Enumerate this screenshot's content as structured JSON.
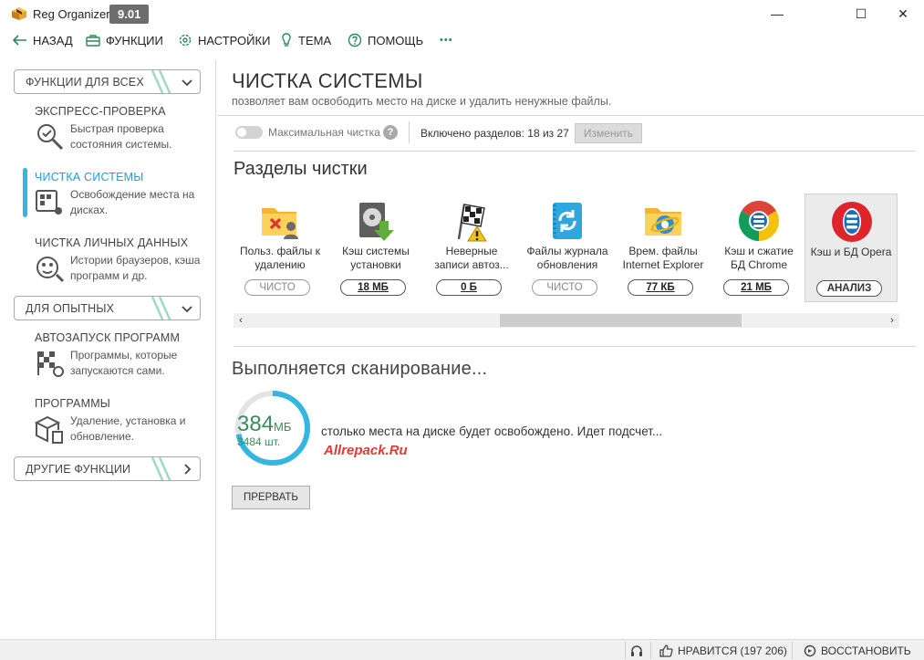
{
  "window": {
    "title": "Reg Organizer",
    "version": "9.01",
    "controls": {
      "minimize": "—",
      "maximize": "☐",
      "close": "✕"
    }
  },
  "menu": {
    "back": "НАЗАД",
    "functions": "ФУНКЦИИ",
    "settings": "НАСТРОЙКИ",
    "theme": "ТЕМА",
    "help": "ПОМОЩЬ",
    "more": "•••"
  },
  "sidebar": {
    "group_all": "ФУНКЦИИ ДЛЯ ВСЕХ",
    "group_advanced": "ДЛЯ ОПЫТНЫХ",
    "group_other": "ДРУГИЕ ФУНКЦИИ",
    "items": [
      {
        "title": "ЭКСПРЕСС-ПРОВЕРКА",
        "desc": "Быстрая проверка состояния системы."
      },
      {
        "title": "ЧИСТКА СИСТЕМЫ",
        "desc": "Освобождение места на дисках."
      },
      {
        "title": "ЧИСТКА ЛИЧНЫХ ДАННЫХ",
        "desc": "Истории браузеров, кэша программ и др."
      },
      {
        "title": "АВТОЗАПУСК ПРОГРАММ",
        "desc": "Программы, которые запускаются сами."
      },
      {
        "title": "ПРОГРАММЫ",
        "desc": "Удаление, установка и обновление."
      }
    ]
  },
  "main": {
    "title": "ЧИСТКА СИСТЕМЫ",
    "subtitle": "позволяет вам освободить место на диске и удалить ненужные файлы.",
    "max_clean_label": "Максимальная чистка",
    "help_glyph": "?",
    "sections_count": "Включено разделов: 18 из 27",
    "change_button": "Изменить",
    "sections_title": "Разделы чистки",
    "cards": [
      {
        "line1": "Польз. файлы к",
        "line2": "удалению",
        "pill": "ЧИСТО",
        "icon": "user-files-icon"
      },
      {
        "line1": "Кэш системы",
        "line2": "установки",
        "pill": "18 МБ",
        "icon": "installer-cache-icon"
      },
      {
        "line1": "Неверные",
        "line2": "записи автоз...",
        "pill": "0 Б",
        "icon": "autorun-flags-icon"
      },
      {
        "line1": "Файлы журнала",
        "line2": "обновления",
        "pill": "ЧИСТО",
        "icon": "update-log-icon"
      },
      {
        "line1": "Врем. файлы",
        "line2": "Internet Explorer",
        "pill": "77 КБ",
        "icon": "ie-temp-icon"
      },
      {
        "line1": "Кэш и сжатие",
        "line2": "БД Chrome",
        "pill": "21 МБ",
        "icon": "chrome-cache-icon"
      },
      {
        "line1": "Кэш и БД Opera",
        "line2": "",
        "pill": "АНАЛИЗ",
        "icon": "opera-cache-icon"
      }
    ],
    "scan_title": "Выполняется сканирование...",
    "scan_size": "384",
    "scan_unit": "МБ",
    "scan_count": "3484 шт.",
    "scan_progress": 0.72,
    "scan_message": "столько места на диске будет освобождено. Идет подсчет...",
    "watermark": "Allrepack.Ru",
    "stop_button": "ПРЕРВАТЬ"
  },
  "status": {
    "like": "НРАВИТСЯ (197 206)",
    "restore": "ВОССТАНОВИТЬ"
  },
  "colors": {
    "accent": "#1e9fd4",
    "progress": "#35b6e0",
    "scan_text": "#3d8a5c",
    "watermark": "#e53737"
  }
}
